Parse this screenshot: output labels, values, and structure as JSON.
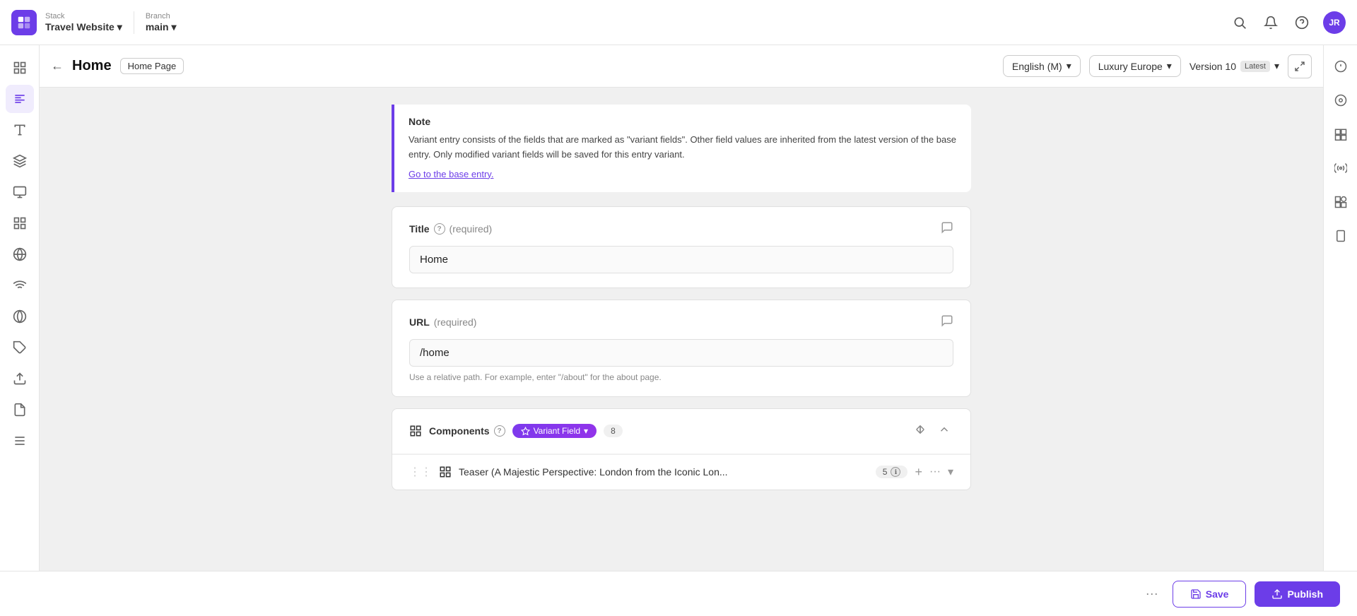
{
  "topNav": {
    "logoAlt": "Stack logo",
    "stackLabel": "Stack",
    "projectName": "Travel Website",
    "branchLabel": "Branch",
    "branchName": "main",
    "userInitials": "JR"
  },
  "headerBar": {
    "backLabel": "←",
    "pageTitle": "Home",
    "pageBadge": "Home Page",
    "locale": "English (M)",
    "localeDropdown": "▾",
    "market": "Luxury Europe",
    "marketDropdown": "▾",
    "version": "Version 10",
    "versionBadge": "Latest",
    "versionDropdown": "▾"
  },
  "note": {
    "title": "Note",
    "text": "Variant entry consists of the fields that are marked as \"variant fields\". Other field values are inherited from the latest version of the base entry. Only modified variant fields will be saved for this entry variant.",
    "linkText": "Go to the base entry."
  },
  "titleField": {
    "label": "Title",
    "required": "(required)",
    "value": "Home"
  },
  "urlField": {
    "label": "URL",
    "required": "(required)",
    "value": "/home",
    "hint": "Use a relative path. For example, enter \"/about\" for the about page."
  },
  "components": {
    "label": "Components",
    "variantBadge": "Variant Field",
    "count": "8",
    "teaser": {
      "title": "Teaser (A Majestic Perspective: London from the Iconic Lon...",
      "count": "5"
    }
  },
  "bottomBar": {
    "saveLabel": "Save",
    "publishLabel": "Publish"
  }
}
